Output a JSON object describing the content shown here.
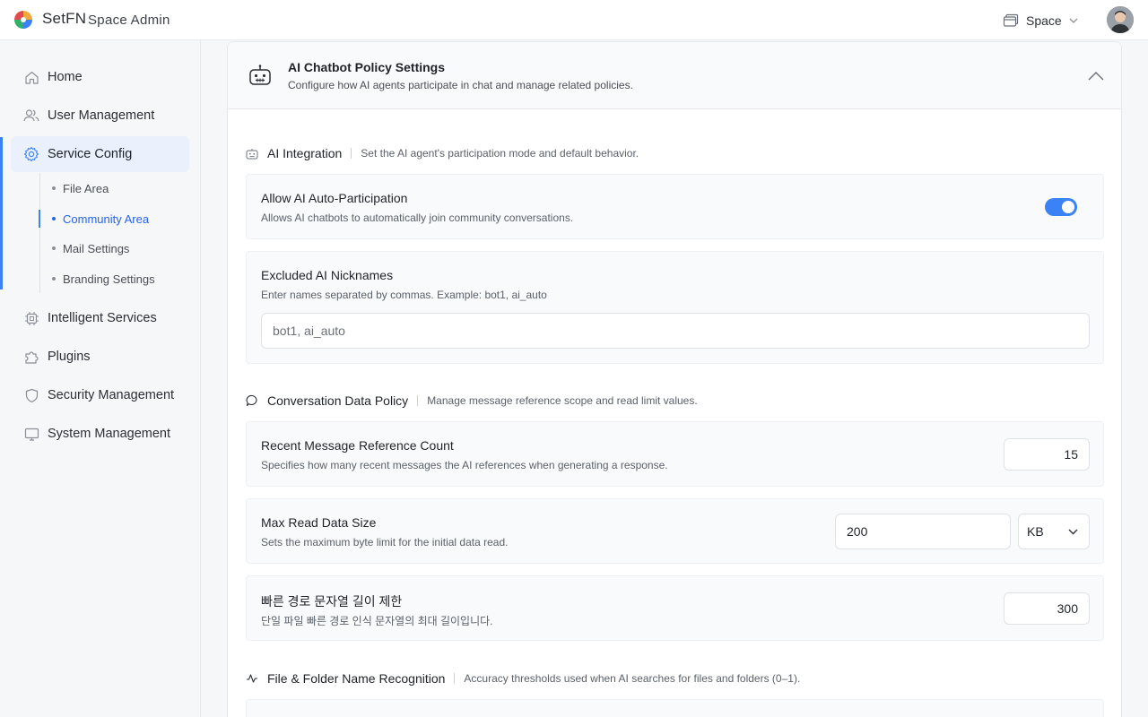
{
  "header": {
    "brand": "SetFN",
    "app_name": "Space Admin",
    "space_label": "Space",
    "logo_icon": "pinwheel-logo-icon",
    "avatar_icon": "user-avatar"
  },
  "sidebar": {
    "items": [
      {
        "label": "Home",
        "icon": "home-icon"
      },
      {
        "label": "User Management",
        "icon": "users-icon"
      },
      {
        "label": "Service Config",
        "icon": "gear-icon",
        "active": true
      },
      {
        "label": "Intelligent Services",
        "icon": "chip-icon"
      },
      {
        "label": "Plugins",
        "icon": "puzzle-icon"
      },
      {
        "label": "Security Management",
        "icon": "shield-icon"
      },
      {
        "label": "System Management",
        "icon": "monitor-icon"
      }
    ],
    "sub_items": [
      {
        "label": "File Area"
      },
      {
        "label": "Community Area",
        "active": true
      },
      {
        "label": "Mail Settings"
      },
      {
        "label": "Branding Settings"
      }
    ]
  },
  "card": {
    "title": "AI Chatbot Policy Settings",
    "subtitle": "Configure how AI agents participate in chat and manage related policies.",
    "icon": "robot-icon"
  },
  "sections": {
    "ai_integration": {
      "title": "AI Integration",
      "desc": "Set the AI agent's participation mode and default behavior.",
      "auto_participation": {
        "title": "Allow AI Auto-Participation",
        "desc": "Allows AI chatbots to automatically join community conversations.",
        "enabled": true
      },
      "excluded_nicknames": {
        "title": "Excluded AI Nicknames",
        "desc": "Enter names separated by commas. Example: bot1, ai_auto",
        "placeholder": "bot1, ai_auto"
      }
    },
    "conversation_policy": {
      "title": "Conversation Data Policy",
      "desc": "Manage message reference scope and read limit values.",
      "recent_count": {
        "title": "Recent Message Reference Count",
        "desc": "Specifies how many recent messages the AI references when generating a response.",
        "value": "15"
      },
      "max_read_size": {
        "title": "Max Read Data Size",
        "desc": "Sets the maximum byte limit for the initial data read.",
        "value": "200",
        "unit": "KB"
      },
      "fast_path_length": {
        "title": "빠른 경로 문자열 길이 제한",
        "desc": "단일 파일 빠른 경로 인식 문자열의 최대 길이입니다.",
        "value": "300"
      }
    },
    "name_recognition": {
      "title": "File & Folder Name Recognition",
      "desc": "Accuracy thresholds used when AI searches for files and folders (0–1)."
    }
  },
  "colors": {
    "accent": "#3b82f6",
    "active_nav_bg": "#eaf1fd",
    "active_sub_text": "#2563eb"
  }
}
